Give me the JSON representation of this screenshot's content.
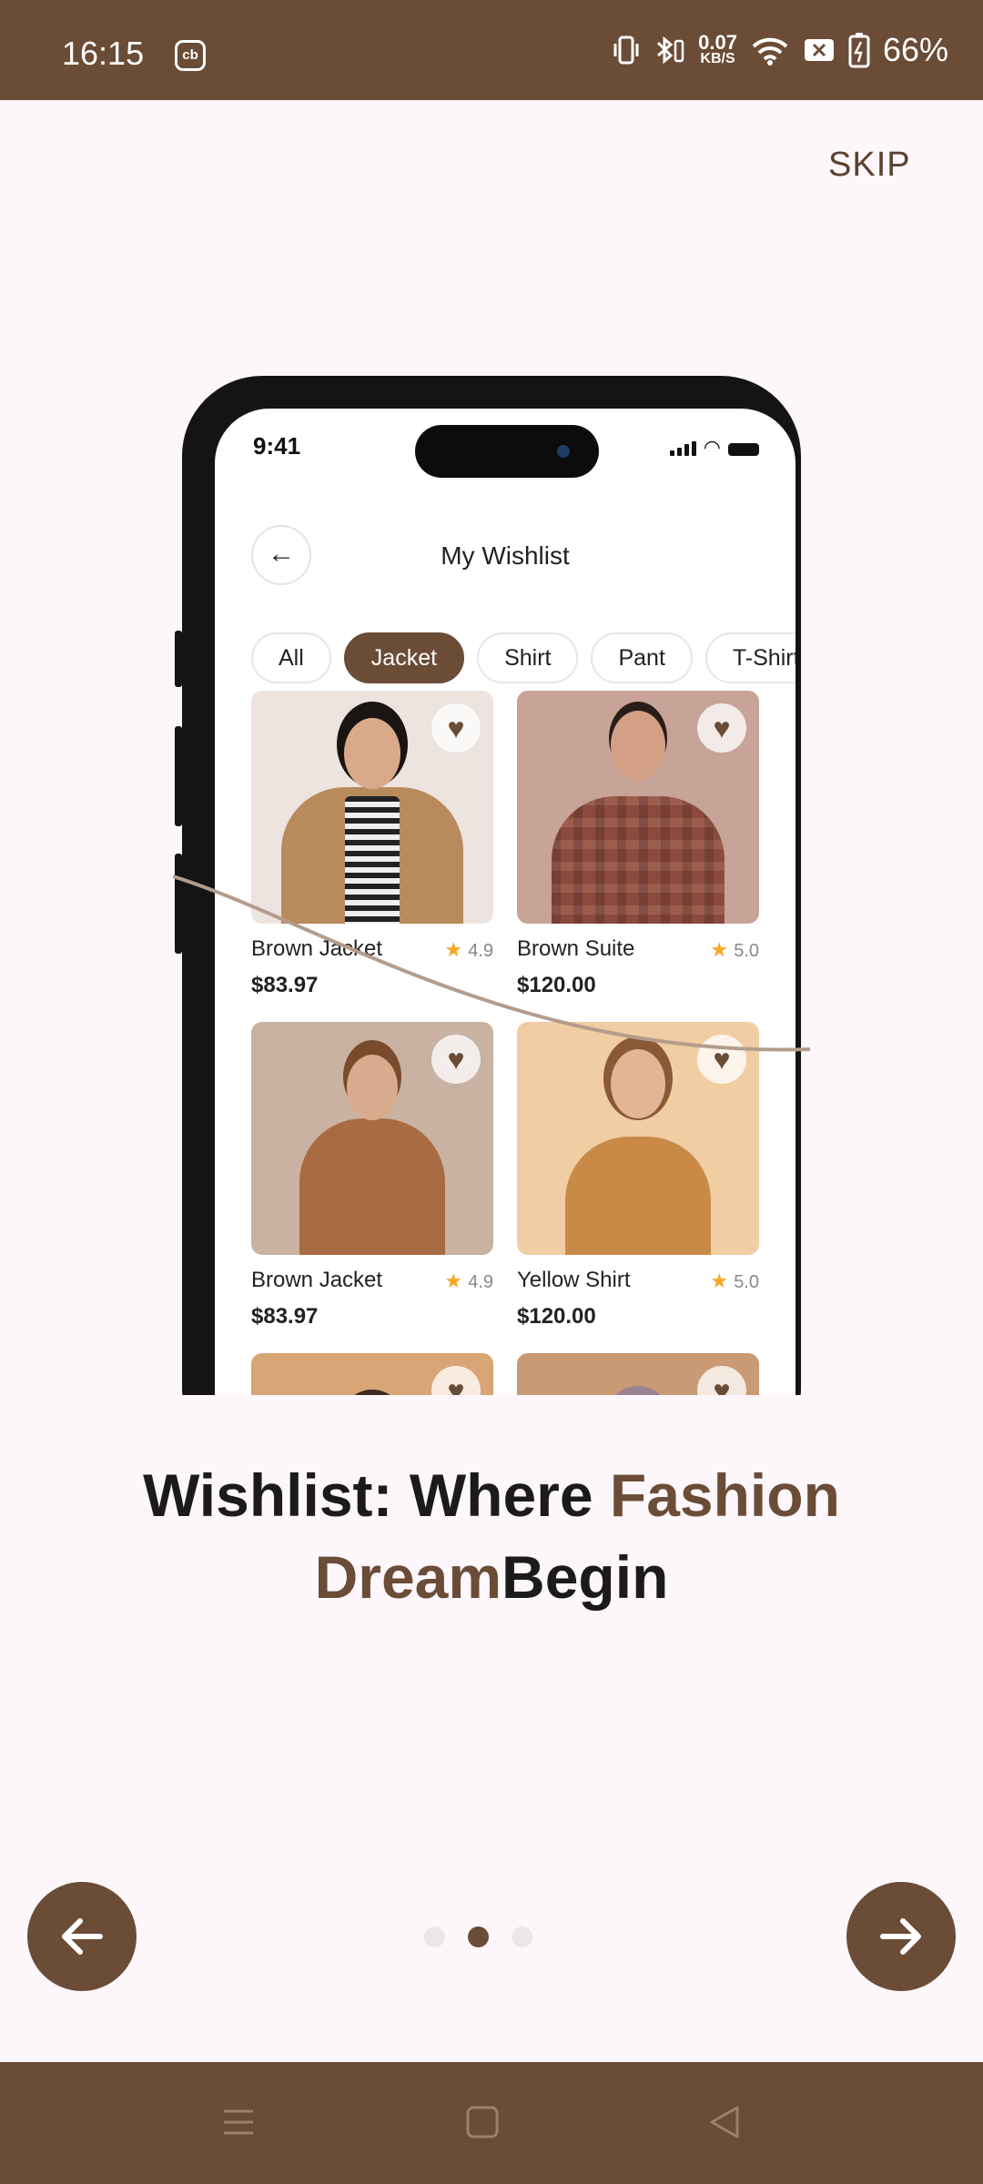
{
  "status_bar": {
    "time": "16:15",
    "cb_label": "cb",
    "net_speed_value": "0.07",
    "net_speed_unit": "KB/S",
    "battery": "66%"
  },
  "skip_label": "SKIP",
  "mockup": {
    "time": "9:41",
    "title": "My Wishlist",
    "chips": [
      {
        "label": "All",
        "active": false
      },
      {
        "label": "Jacket",
        "active": true
      },
      {
        "label": "Shirt",
        "active": false
      },
      {
        "label": "Pant",
        "active": false
      },
      {
        "label": "T-Shirt",
        "active": false
      }
    ],
    "products": [
      {
        "name": "Brown Jacket",
        "rating": "4.9",
        "price": "$83.97"
      },
      {
        "name": "Brown Suite",
        "rating": "5.0",
        "price": "$120.00"
      },
      {
        "name": "Brown Jacket",
        "rating": "4.9",
        "price": "$83.97"
      },
      {
        "name": "Yellow Shirt",
        "rating": "5.0",
        "price": "$120.00"
      }
    ]
  },
  "headline": {
    "part1": "Wishlist: Where ",
    "accent1": "Fashion",
    "accent2": "Dream",
    "part2": "Begin"
  },
  "pagination": {
    "total": 3,
    "active_index": 1
  },
  "colors": {
    "brand": "#6b4c36",
    "background": "#fdf7fc",
    "star": "#f5a623"
  },
  "icons": {
    "prev": "arrow-left-icon",
    "next": "arrow-right-icon",
    "heart": "heart-icon",
    "star": "star-icon",
    "nav_recents": "menu-icon",
    "nav_home": "square-icon",
    "nav_back": "triangle-back-icon"
  }
}
